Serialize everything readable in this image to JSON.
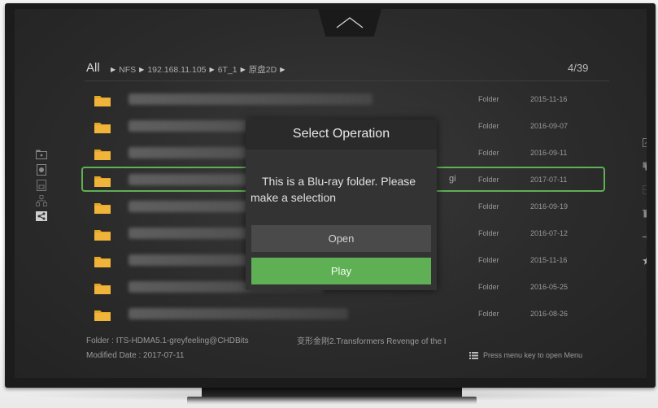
{
  "breadcrumb": {
    "root_label": "All",
    "items": [
      "NFS",
      "192.168.11.105",
      "6T_1",
      "原盘2D"
    ],
    "page_count": "4/39"
  },
  "file_list": {
    "rows": [
      {
        "type": "Folder",
        "date": "2015-11-16"
      },
      {
        "type": "Folder",
        "date": "2016-09-07"
      },
      {
        "type": "Folder",
        "date": "2016-09-11"
      },
      {
        "type": "Folder",
        "date": "2017-07-11",
        "selected": true,
        "visible_text": "gi"
      },
      {
        "type": "Folder",
        "date": "2016-09-19"
      },
      {
        "type": "Folder",
        "date": "2016-07-12"
      },
      {
        "type": "Folder",
        "date": "2015-11-16"
      },
      {
        "type": "Folder",
        "date": "2016-05-25"
      },
      {
        "type": "Folder",
        "date": "2016-08-26"
      }
    ]
  },
  "info": {
    "folder_label": "Folder",
    "folder_value": "ITS-HDMA5.1-greyfeeling@CHDBits",
    "name_value": "变形金刚2.Transformers Revenge of the I",
    "modified_label": "Modified Date",
    "modified_value": "2017-07-11",
    "menu_hint": "Press menu key to open Menu"
  },
  "dialog": {
    "title": "Select Operation",
    "message": "This is a Blu-ray folder. Please make a selection",
    "buttons": {
      "open_label": "Open",
      "play_label": "Play"
    }
  },
  "icons": {
    "left_nav": [
      "folder-icon",
      "globe-icon",
      "device-icon",
      "network-icon",
      "share-icon"
    ],
    "right_nav": [
      "edit-icon",
      "copy-icon",
      "grid-icon",
      "delete-icon",
      "move-icon",
      "star-icon"
    ],
    "top": "chevron-up-icon"
  },
  "colors": {
    "accent": "#5faf55",
    "folder": "#e5a526",
    "background": "#2b2b2b"
  }
}
